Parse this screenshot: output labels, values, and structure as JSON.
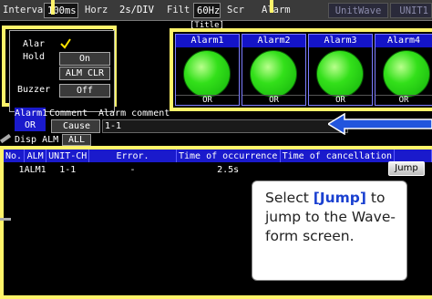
{
  "topbar": {
    "interval_label": "Interval",
    "interval_value": "100ms",
    "horz_label": "Horz",
    "horz_value": "2s/DIV",
    "filt_label": "Filt",
    "filt_value": "60Hz",
    "screen_label": "Scr",
    "alarm_label": "Alarm",
    "unitwave_label": "UnitWave",
    "unit_label": "UNIT1"
  },
  "title_tag": "[Title]",
  "settings": {
    "alarm_label": "Alar",
    "alarm_checked": true,
    "hold_label": "Hold",
    "hold_value": "On",
    "alm_clr_label": "ALM CLR",
    "buzzer_label": "Buzzer",
    "buzzer_value": "Off"
  },
  "alarms": [
    {
      "name": "Alarm1",
      "status": "OR"
    },
    {
      "name": "Alarm2",
      "status": "OR"
    },
    {
      "name": "Alarm3",
      "status": "OR"
    },
    {
      "name": "Alarm4",
      "status": "OR"
    }
  ],
  "comment_row": {
    "alarm": "Alarm1",
    "status": "OR",
    "comment_label": "Comment",
    "alarm_comment_label": "Alarm comment",
    "cause_label": "Cause",
    "cause_value": "1-1"
  },
  "disp_alm": {
    "label": "Disp ALM",
    "value": "ALL"
  },
  "table": {
    "headers": [
      "No.",
      "ALM",
      "UNIT-CH",
      "Error.",
      "Time of occurrence",
      "Time of cancellation"
    ],
    "rows": [
      {
        "no": "1",
        "alm": "ALM1",
        "unit_ch": "1-1",
        "error": "-",
        "occurrence": "2.5s",
        "cancellation": ""
      }
    ],
    "jump_label": "Jump"
  },
  "note": {
    "line1a": "Select ",
    "line1b": "[Jump]",
    "line1c": " to",
    "line2": "jump to the Wave-",
    "line3": "form screen."
  },
  "colors": {
    "callout_frame": "#fff36a",
    "table_header": "#1a1acc",
    "lamp": "#33e01a",
    "arrow": "#2255dd"
  }
}
